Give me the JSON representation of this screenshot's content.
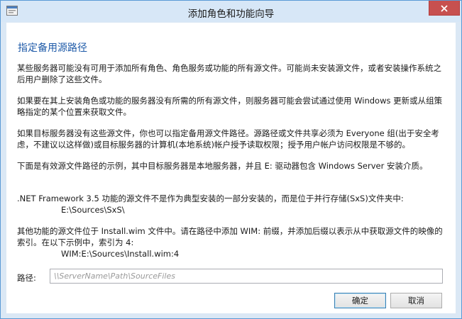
{
  "window": {
    "title": "添加角色和功能向导",
    "close_label": "✕"
  },
  "main": {
    "heading": "指定备用源路径",
    "para1": "某些服务器可能没有可用于添加所有角色、角色服务或功能的所有源文件。可能尚未安装源文件，或者安装操作系统之后用户删除了这些文件。",
    "para2": "如果要在其上安装角色或功能的服务器没有所需的所有源文件，则服务器可能会尝试通过使用 Windows 更新或从组策略指定的某个位置来获取文件。",
    "para3": "如果目标服务器没有这些源文件，你也可以指定备用源文件路径。源路径或文件共享必须为 Everyone 组(出于安全考虑，不建议以这样做)或目标服务器的计算机(本地系统)帐户授予读取权限；授予用户帐户访问权限是不够的。",
    "para4": "下面是有效源文件路径的示例，其中目标服务器是本地服务器，并且 E: 驱动器包含 Windows Server 安装介质。",
    "para5_text": ".NET Framework 3.5 功能的源文件不是作为典型安装的一部分安装的，而是位于并行存储(SxS)文件夹中:",
    "para5_example": "E:\\Sources\\SxS\\",
    "para6_text": "其他功能的源文件位于 Install.wim 文件中。请在路径中添加 WIM: 前缀，并添加后缀以表示从中获取源文件的映像的索引。在以下示例中，索引为 4:",
    "para6_example": "WIM:E:\\Sources\\Install.wim:4"
  },
  "path": {
    "label": "路径:",
    "value": "",
    "placeholder": "\\\\ServerName\\Path\\SourceFiles"
  },
  "buttons": {
    "ok": "确定",
    "cancel": "取消"
  },
  "colors": {
    "heading": "#1e5aa8",
    "close_button": "#c7504f",
    "window_frame": "#dbe8f5"
  }
}
